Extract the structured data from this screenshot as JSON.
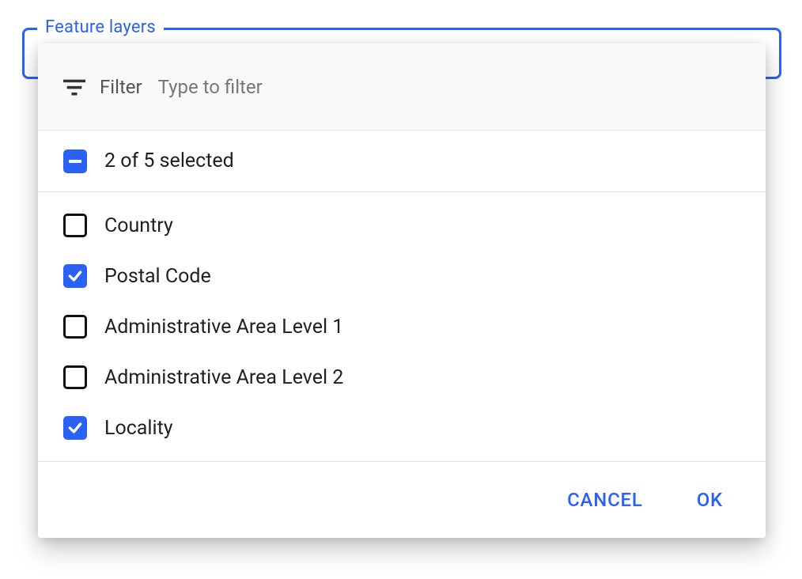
{
  "colors": {
    "primary": "#2a62f8"
  },
  "field": {
    "legend": "Feature layers"
  },
  "filter": {
    "label": "Filter",
    "placeholder": "Type to filter",
    "value": ""
  },
  "summary": {
    "text": "2 of 5 selected",
    "state": "indeterminate"
  },
  "options": [
    {
      "label": "Country",
      "checked": false
    },
    {
      "label": "Postal Code",
      "checked": true
    },
    {
      "label": "Administrative Area Level 1",
      "checked": false
    },
    {
      "label": "Administrative Area Level 2",
      "checked": false
    },
    {
      "label": "Locality",
      "checked": true
    }
  ],
  "actions": {
    "cancel": "CANCEL",
    "ok": "OK"
  }
}
